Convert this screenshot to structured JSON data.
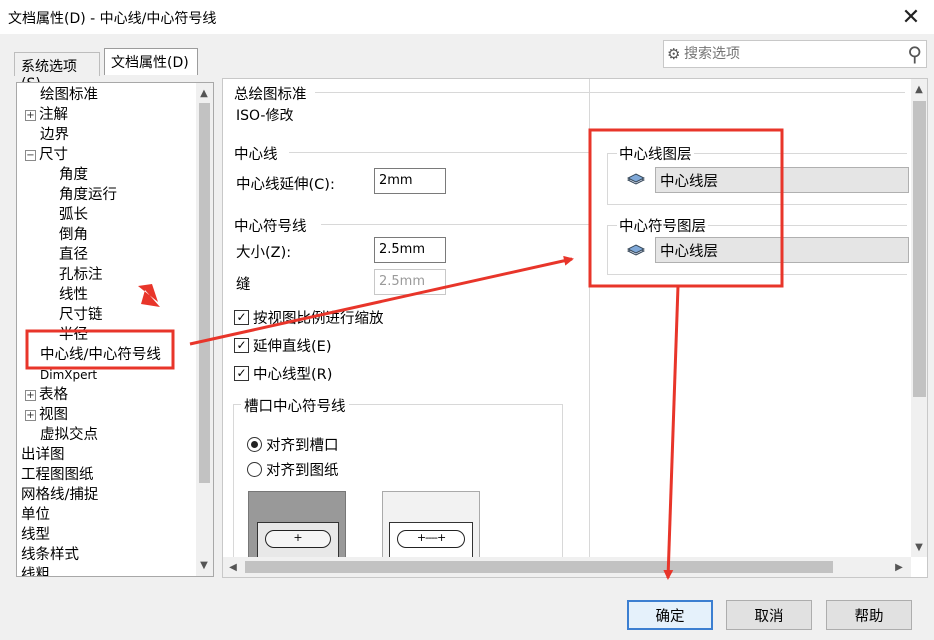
{
  "window": {
    "title": "文档属性(D) - 中心线/中心符号线",
    "close_glyph": "✕"
  },
  "tabs": [
    {
      "label": "系统选项(S)"
    },
    {
      "label": "文档属性(D)",
      "active": true
    }
  ],
  "search": {
    "placeholder": "搜索选项"
  },
  "tree": [
    {
      "label": "绘图标准",
      "level": 0,
      "expander": ""
    },
    {
      "label": "注解",
      "level": 0,
      "expander": "+"
    },
    {
      "label": "边界",
      "level": 0,
      "expander": ""
    },
    {
      "label": "尺寸",
      "level": 0,
      "expander": "-"
    },
    {
      "label": "角度",
      "level": 1
    },
    {
      "label": "角度运行",
      "level": 1
    },
    {
      "label": "弧长",
      "level": 1
    },
    {
      "label": "倒角",
      "level": 1
    },
    {
      "label": "直径",
      "level": 1
    },
    {
      "label": "孔标注",
      "level": 1
    },
    {
      "label": "线性",
      "level": 1
    },
    {
      "label": "尺寸链",
      "level": 1
    },
    {
      "label": "半径",
      "level": 1
    },
    {
      "label": "中心线/中心符号线",
      "level": 0,
      "selected": true
    },
    {
      "label": "DimXpert",
      "level": 0
    },
    {
      "label": "表格",
      "level": 0,
      "expander": "+"
    },
    {
      "label": "视图",
      "level": 0,
      "expander": "+"
    },
    {
      "label": "虚拟交点",
      "level": 0
    },
    {
      "label": "出详图",
      "level": -1
    },
    {
      "label": "工程图图纸",
      "level": -1
    },
    {
      "label": "网格线/捕捉",
      "level": -1
    },
    {
      "label": "单位",
      "level": -1
    },
    {
      "label": "线型",
      "level": -1
    },
    {
      "label": "线条样式",
      "level": -1
    },
    {
      "label": "线粗",
      "level": -1
    }
  ],
  "overall_standard": {
    "title": "总绘图标准",
    "value": "ISO-修改"
  },
  "centerline": {
    "title": "中心线",
    "extension_label": "中心线延伸(C):",
    "extension_value": "2mm"
  },
  "centermark": {
    "title": "中心符号线",
    "size_label": "大小(Z):",
    "size_value": "2.5mm",
    "gap_label": "缝",
    "gap_value": "2.5mm",
    "checkboxes": [
      {
        "label": "按视图比例进行缩放",
        "checked": true
      },
      {
        "label": "延伸直线(E)",
        "checked": true
      },
      {
        "label": "中心线型(R)",
        "checked": true
      }
    ]
  },
  "slot": {
    "title": "槽口中心符号线",
    "options": [
      {
        "label": "对齐到槽口",
        "selected": true
      },
      {
        "label": "对齐到图纸",
        "selected": false
      }
    ]
  },
  "layers": {
    "centerline_title": "中心线图层",
    "centerline_value": "中心线层",
    "centermark_title": "中心符号图层",
    "centermark_value": "中心线层"
  },
  "buttons": {
    "ok": "确定",
    "cancel": "取消",
    "help": "帮助"
  },
  "colors": {
    "annotation": "#e8352a",
    "accent": "#3c7fd1"
  }
}
